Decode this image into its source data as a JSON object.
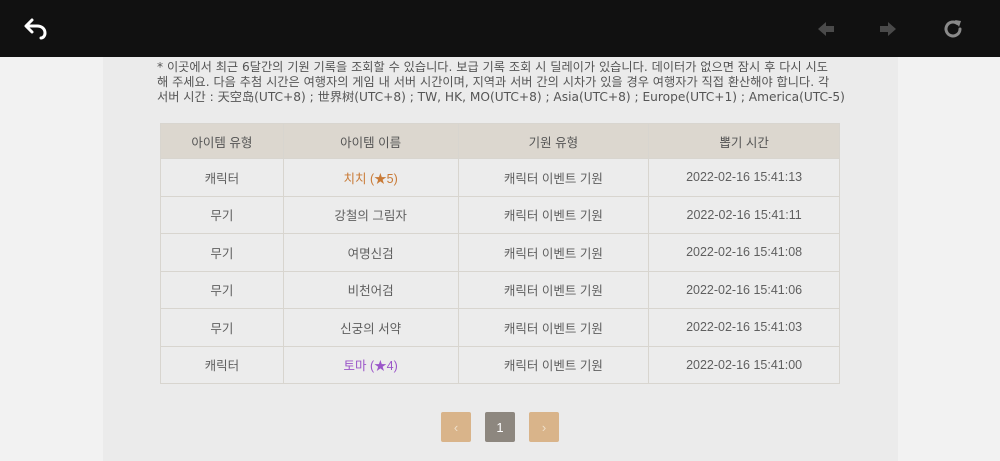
{
  "toolbar": {
    "back_icon": "back-arrow-icon",
    "prev_icon": "left-arrow-icon",
    "next_icon": "right-arrow-icon",
    "refresh_icon": "refresh-icon"
  },
  "notice": {
    "line1": "* 이곳에서 최근 6달간의 기원 기록을 조회할 수 있습니다. 보급 기록 조회 시 딜레이가 있습니다. 데이터가 없으면 잠시 후 다시 시도",
    "line2": "해 주세요. 다음 추첨 시간은 여행자의 게임 내 서버 시간이며, 지역과 서버 간의 시차가 있을 경우 여행자가 직접 환산해야 합니다. 각",
    "line3": "서버 시간 : 天空岛(UTC+8) ; 世界树(UTC+8) ; TW, HK, MO(UTC+8) ; Asia(UTC+8) ; Europe(UTC+1) ; America(UTC-5)"
  },
  "table": {
    "headers": [
      "아이템 유형",
      "아이템 이름",
      "기원 유형",
      "뽑기 시간"
    ],
    "rows": [
      {
        "type": "캐릭터",
        "name": "치치 (★5)",
        "wish": "캐릭터 이벤트 기원",
        "time": "2022-02-16 15:41:13"
      },
      {
        "type": "무기",
        "name": "강철의 그림자",
        "wish": "캐릭터 이벤트 기원",
        "time": "2022-02-16 15:41:11"
      },
      {
        "type": "무기",
        "name": "여명신검",
        "wish": "캐릭터 이벤트 기원",
        "time": "2022-02-16 15:41:08"
      },
      {
        "type": "무기",
        "name": "비천어검",
        "wish": "캐릭터 이벤트 기원",
        "time": "2022-02-16 15:41:06"
      },
      {
        "type": "무기",
        "name": "신궁의 서약",
        "wish": "캐릭터 이벤트 기원",
        "time": "2022-02-16 15:41:03"
      },
      {
        "type": "캐릭터",
        "name": "토마 (★4)",
        "wish": "캐릭터 이벤트 기원",
        "time": "2022-02-16 15:41:00"
      }
    ]
  },
  "pagination": {
    "prev": "‹",
    "current": "1",
    "next": "›"
  },
  "colors": {
    "topbar": "#111111",
    "five_star": "#c97a36",
    "four_star": "#9b56c9",
    "pager_button": "#d9b48a",
    "pager_active": "#8d877f"
  }
}
